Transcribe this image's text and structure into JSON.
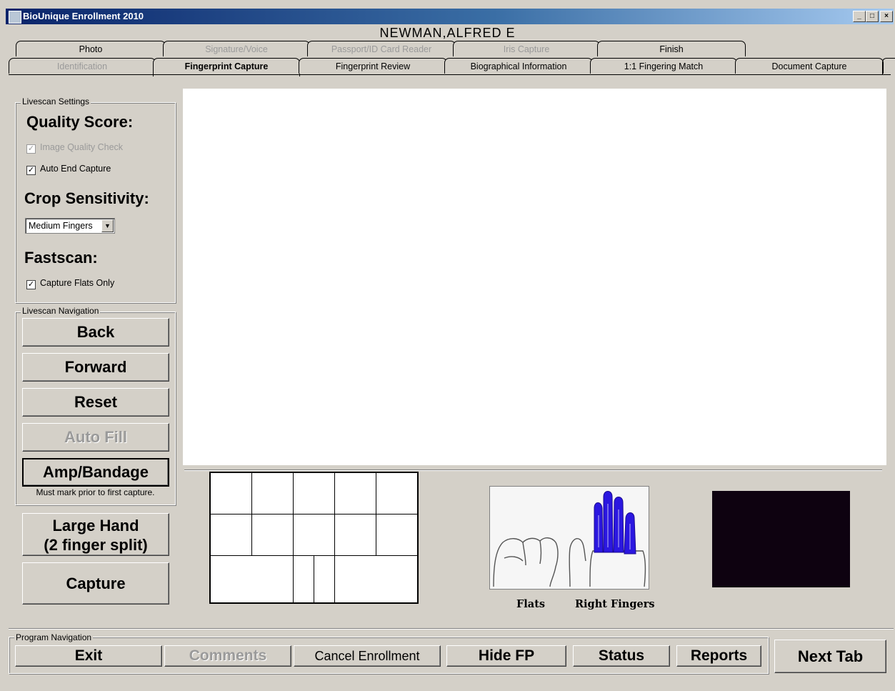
{
  "window": {
    "title": "BioUnique Enrollment 2010",
    "minimize": "_",
    "maximize": "□",
    "close": "×"
  },
  "patient_name": "NEWMAN,ALFRED E",
  "tabs_top": [
    {
      "label": "Photo",
      "enabled": true
    },
    {
      "label": "Signature/Voice",
      "enabled": false
    },
    {
      "label": "Passport/ID Card Reader",
      "enabled": false
    },
    {
      "label": "Iris Capture",
      "enabled": false
    },
    {
      "label": "Finish",
      "enabled": true
    }
  ],
  "tabs_bottom": [
    {
      "label": "Identification",
      "enabled": false
    },
    {
      "label": "Fingerprint Capture",
      "enabled": true,
      "active": true
    },
    {
      "label": "Fingerprint Review",
      "enabled": true
    },
    {
      "label": "Biographical Information",
      "enabled": true
    },
    {
      "label": "1:1 Fingering Match",
      "enabled": true
    },
    {
      "label": "Document Capture",
      "enabled": true
    }
  ],
  "livescan_settings": {
    "group_label": "Livescan Settings",
    "quality_heading": "Quality Score:",
    "image_quality_check": {
      "label": "Image Quality Check",
      "checked": true,
      "enabled": false
    },
    "auto_end_capture": {
      "label": "Auto End Capture",
      "checked": true
    },
    "crop_heading": "Crop Sensitivity:",
    "crop_value": "Medium Fingers",
    "fastscan_heading": "Fastscan:",
    "capture_flats_only": {
      "label": "Capture Flats Only",
      "checked": true
    }
  },
  "livescan_navigation": {
    "group_label": "Livescan Navigation",
    "back": "Back",
    "forward": "Forward",
    "reset": "Reset",
    "auto_fill": "Auto Fill",
    "amp_bandage": "Amp/Bandage",
    "amp_note": "Must mark prior to first capture."
  },
  "large_hand": {
    "line1": "Large Hand",
    "line2": "(2 finger split)"
  },
  "capture": "Capture",
  "captions": {
    "flats": "Flats",
    "right_fingers": "Right Fingers"
  },
  "program_navigation": {
    "group_label": "Program Navigation",
    "exit": "Exit",
    "comments": "Comments",
    "cancel_enrollment": "Cancel Enrollment",
    "hide_fp": "Hide FP",
    "status": "Status",
    "reports": "Reports"
  },
  "next_tab": "Next Tab",
  "colors": {
    "highlight_fingers": "#2b17e0",
    "preview_bg": "#0e0210",
    "titlebar": "#0a246a"
  }
}
